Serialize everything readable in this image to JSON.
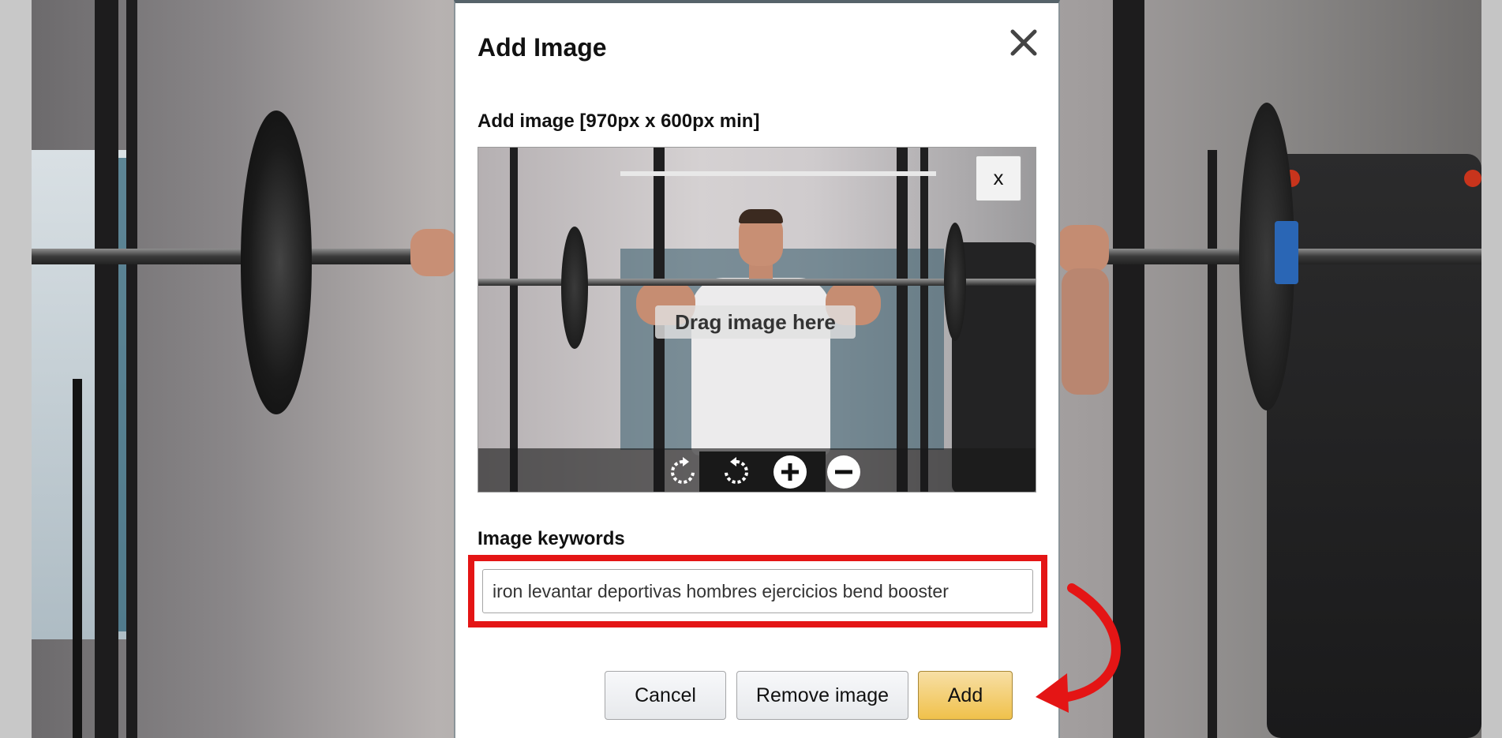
{
  "dialog": {
    "title": "Add Image",
    "close_icon": "close-icon"
  },
  "image_section": {
    "label": "Add image [970px x 600px min]",
    "drag_text": "Drag image here",
    "remove_x_label": "x",
    "toolbar_icons": [
      "rotate-clockwise-icon",
      "rotate-counterclockwise-icon",
      "zoom-in-icon",
      "zoom-out-icon"
    ]
  },
  "keywords_section": {
    "label": "Image keywords",
    "value": "iron levantar deportivas hombres ejercicios bend booster"
  },
  "actions": {
    "cancel": "Cancel",
    "remove_image": "Remove image",
    "add": "Add"
  },
  "colors": {
    "highlight": "#e41515",
    "add_button": "#f0c14b",
    "arrow": "#e41515"
  }
}
